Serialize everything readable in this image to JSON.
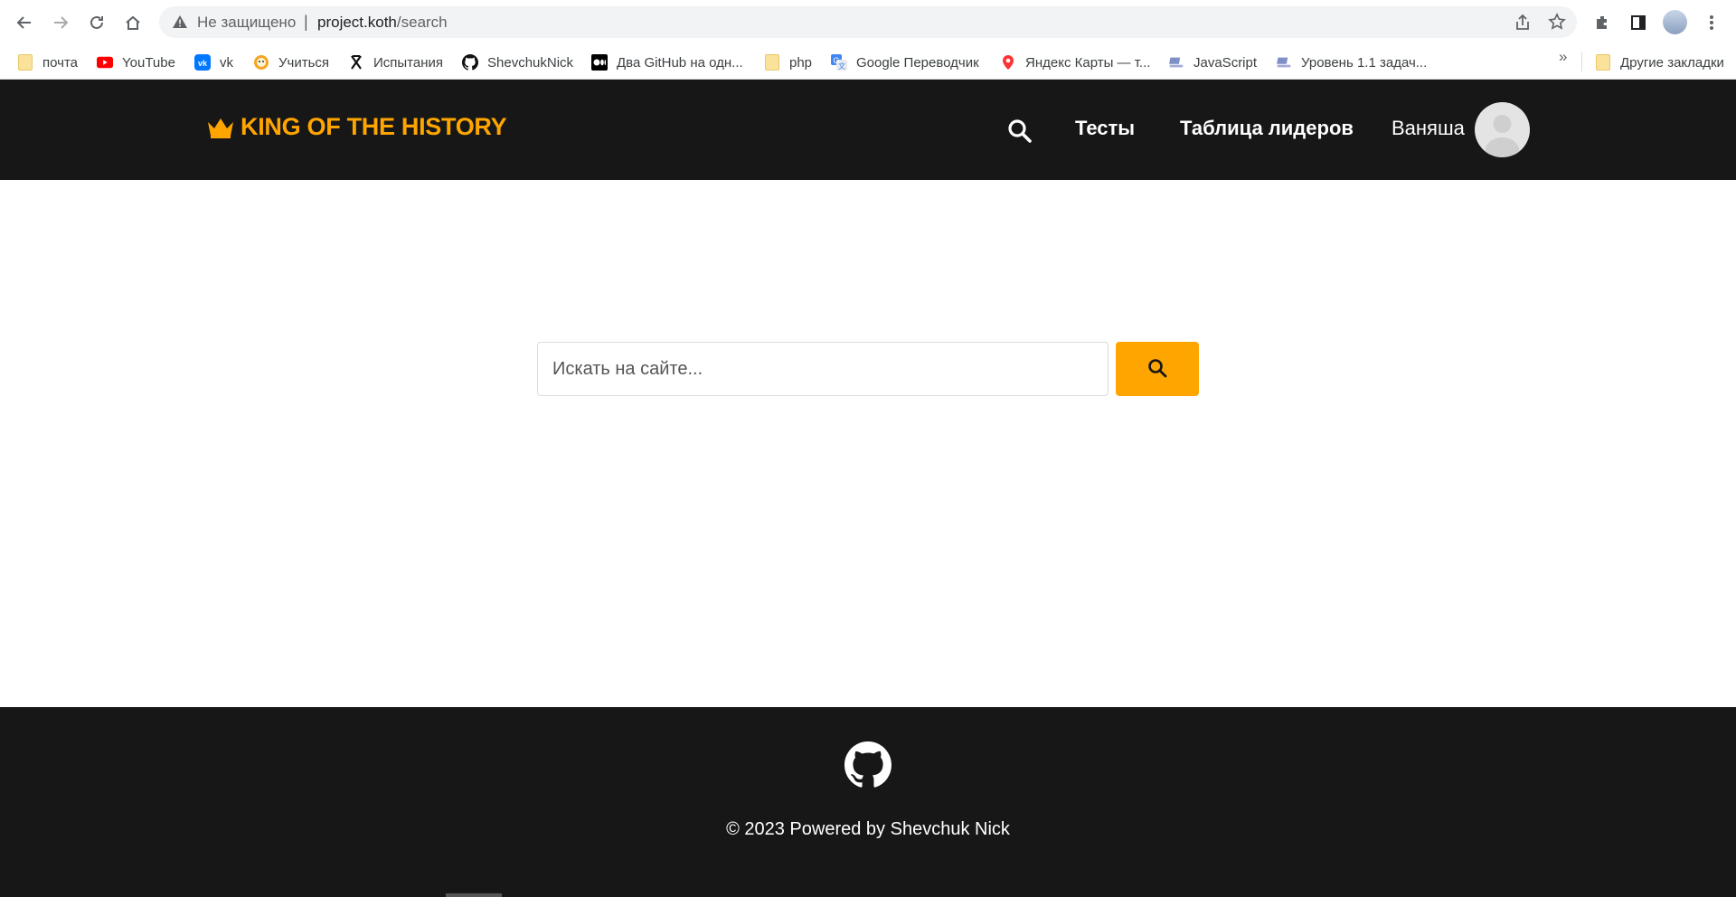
{
  "browser": {
    "security_label": "Не защищено",
    "separator": "|",
    "url_host": "project.koth",
    "url_path": "/search",
    "icons": [
      "back-icon",
      "forward-icon",
      "reload-icon",
      "home-icon",
      "warning-icon",
      "share-icon",
      "star-icon",
      "extensions-icon",
      "sidebar-icon",
      "menu-icon"
    ]
  },
  "bookmarks": {
    "items": [
      {
        "label": "почта",
        "icon": "folder-icon"
      },
      {
        "label": "YouTube",
        "icon": "youtube-icon"
      },
      {
        "label": "vk",
        "icon": "vk-icon"
      },
      {
        "label": "Учиться",
        "icon": "lion-icon"
      },
      {
        "label": "Испытания",
        "icon": "x-icon"
      },
      {
        "label": "ShevchukNick",
        "icon": "github-icon"
      },
      {
        "label": "Два GitHub на одн...",
        "icon": "medium-icon"
      },
      {
        "label": "php",
        "icon": "folder-icon"
      },
      {
        "label": "Google Переводчик",
        "icon": "translate-icon"
      },
      {
        "label": "Яндекс Карты — т...",
        "icon": "map-pin-icon"
      },
      {
        "label": "JavaScript",
        "icon": "laptop-icon"
      },
      {
        "label": "Уровень 1.1 задач...",
        "icon": "laptop-icon"
      }
    ],
    "more": "»",
    "other": "Другие закладки"
  },
  "header": {
    "logo_text": "KING OF THE HISTORY",
    "nav": {
      "tests": "Тесты",
      "leaderboard": "Таблица лидеров",
      "user": "Ваняша"
    }
  },
  "search": {
    "placeholder": "Искать на сайте...",
    "value": ""
  },
  "footer": {
    "copyright": "© 2023 Powered by Shevchuk Nick"
  },
  "colors": {
    "accent": "#ffa500",
    "dark": "#171717"
  }
}
